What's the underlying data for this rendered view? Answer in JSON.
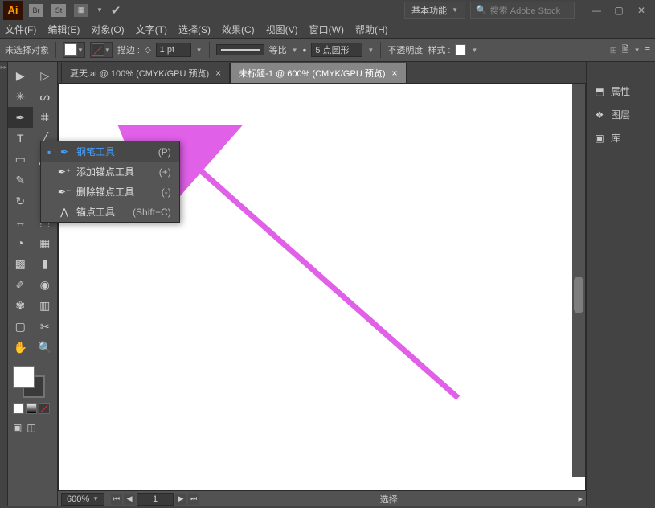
{
  "title": {
    "logo": "Ai",
    "workspace_label": "基本功能",
    "search_placeholder": "搜索 Adobe Stock"
  },
  "menu": {
    "file": "文件(F)",
    "edit": "编辑(E)",
    "object": "对象(O)",
    "type": "文字(T)",
    "select": "选择(S)",
    "effect": "效果(C)",
    "view": "视图(V)",
    "window": "窗口(W)",
    "help": "帮助(H)"
  },
  "options": {
    "no_selection": "未选择对象",
    "stroke_label": "描边 :",
    "stroke_weight": "1 pt",
    "ratio_label": "等比",
    "brush_value": "5 点圆形",
    "opacity_label": "不透明度",
    "style_label": "样式 :"
  },
  "tabs": [
    {
      "label": "夏天.ai @ 100% (CMYK/GPU 预览)",
      "active": false
    },
    {
      "label": "未标题-1 @ 600% (CMYK/GPU 预览)",
      "active": true
    }
  ],
  "flyout": {
    "items": [
      {
        "label": "钢笔工具",
        "key": "(P)",
        "selected": true
      },
      {
        "label": "添加锚点工具",
        "key": "(+)",
        "selected": false
      },
      {
        "label": "删除锚点工具",
        "key": "(-)",
        "selected": false
      },
      {
        "label": "锚点工具",
        "key": "(Shift+C)",
        "selected": false
      }
    ]
  },
  "rightpanel": {
    "properties": "属性",
    "layers": "图层",
    "libraries": "库"
  },
  "status": {
    "zoom": "600%",
    "page": "1",
    "mode": "选择"
  }
}
